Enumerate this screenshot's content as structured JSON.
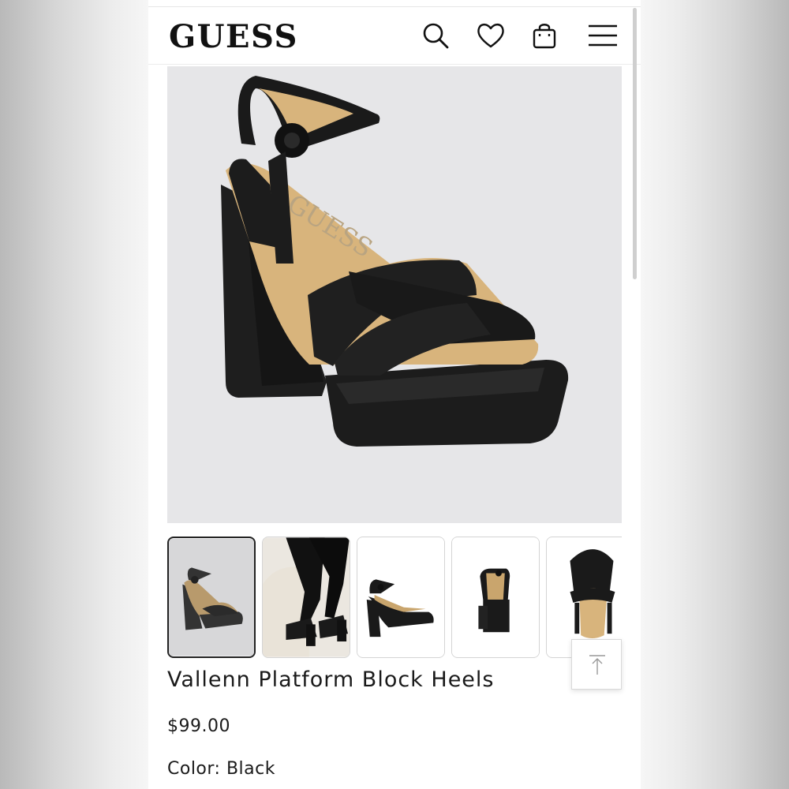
{
  "header": {
    "logo": "GUESS",
    "icons": [
      "search-icon",
      "heart-icon",
      "shopping-bag-icon",
      "menu-icon"
    ]
  },
  "product": {
    "name": "Vallenn Platform Block Heels",
    "price": "$99.00",
    "color_label": "Color:",
    "color_value": "Black",
    "insole_print": "GUESS"
  },
  "gallery": {
    "thumbnail_count": 5,
    "selected_index": 0,
    "thumbnails": [
      "angle-view",
      "worn-view",
      "side-view",
      "back-view",
      "top-view"
    ]
  },
  "colors": {
    "shoe": "#1c1c1c",
    "insole": "#d8b47c",
    "hero_bg": "#e6e6e8"
  }
}
